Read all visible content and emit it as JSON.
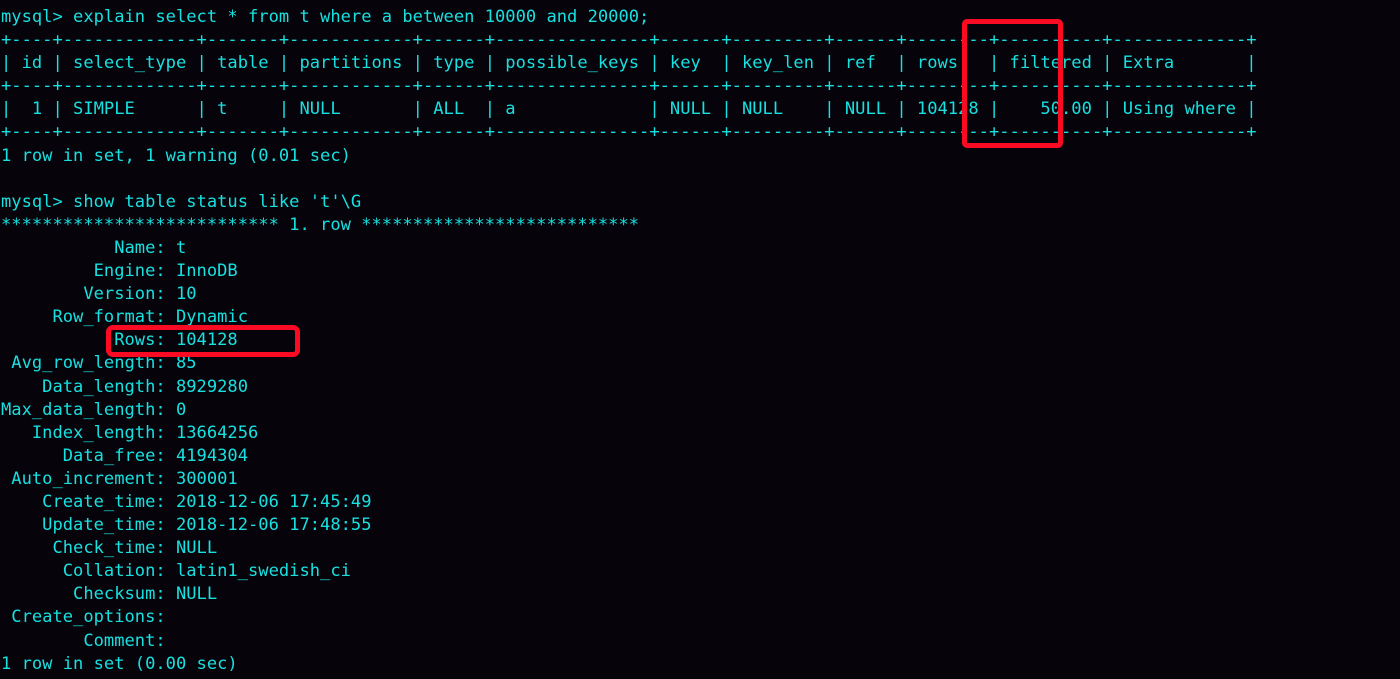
{
  "terminal": {
    "prompt": "mysql>",
    "text_color": "#17e0e0",
    "background_color": "#07030a",
    "highlight_color": "#fb0a23"
  },
  "session": {
    "command_1": "mysql> explain select * from t where a between 10000 and 20000;",
    "explain_table": {
      "separator": "+----+-------------+-------+------------+------+---------------+------+---------+------+--------+----------+-------------+",
      "header": "| id | select_type | table | partitions | type | possible_keys | key  | key_len | ref  | rows   | filtered | Extra       |",
      "row": "|  1 | SIMPLE      | t     | NULL       | ALL  | a             | NULL | NULL    | NULL | 104128 |    50.00 | Using where |",
      "columns": [
        "id",
        "select_type",
        "table",
        "partitions",
        "type",
        "possible_keys",
        "key",
        "key_len",
        "ref",
        "rows",
        "filtered",
        "Extra"
      ],
      "values": [
        "1",
        "SIMPLE",
        "t",
        "NULL",
        "ALL",
        "a",
        "NULL",
        "NULL",
        "NULL",
        "104128",
        "50.00",
        "Using where"
      ]
    },
    "result_1": "1 row in set, 1 warning (0.01 sec)",
    "blank_1": "",
    "command_2": "mysql> show table status like 't'\\G",
    "row_banner": "*************************** 1. row ***************************",
    "status_fields": [
      {
        "label": "Name",
        "value": "t"
      },
      {
        "label": "Engine",
        "value": "InnoDB"
      },
      {
        "label": "Version",
        "value": "10"
      },
      {
        "label": "Row_format",
        "value": "Dynamic"
      },
      {
        "label": "Rows",
        "value": "104128"
      },
      {
        "label": "Avg_row_length",
        "value": "85"
      },
      {
        "label": "Data_length",
        "value": "8929280"
      },
      {
        "label": "Max_data_length",
        "value": "0"
      },
      {
        "label": "Index_length",
        "value": "13664256"
      },
      {
        "label": "Data_free",
        "value": "4194304"
      },
      {
        "label": "Auto_increment",
        "value": "300001"
      },
      {
        "label": "Create_time",
        "value": "2018-12-06 17:45:49"
      },
      {
        "label": "Update_time",
        "value": "2018-12-06 17:48:55"
      },
      {
        "label": "Check_time",
        "value": "NULL"
      },
      {
        "label": "Collation",
        "value": "latin1_swedish_ci"
      },
      {
        "label": "Checksum",
        "value": "NULL"
      },
      {
        "label": "Create_options",
        "value": ""
      },
      {
        "label": "Comment",
        "value": ""
      }
    ],
    "result_2": "1 row in set (0.00 sec)"
  },
  "annotations": [
    {
      "name": "rows-column-highlight",
      "target": "rows"
    },
    {
      "name": "rows-field-highlight",
      "target": "Rows"
    }
  ]
}
